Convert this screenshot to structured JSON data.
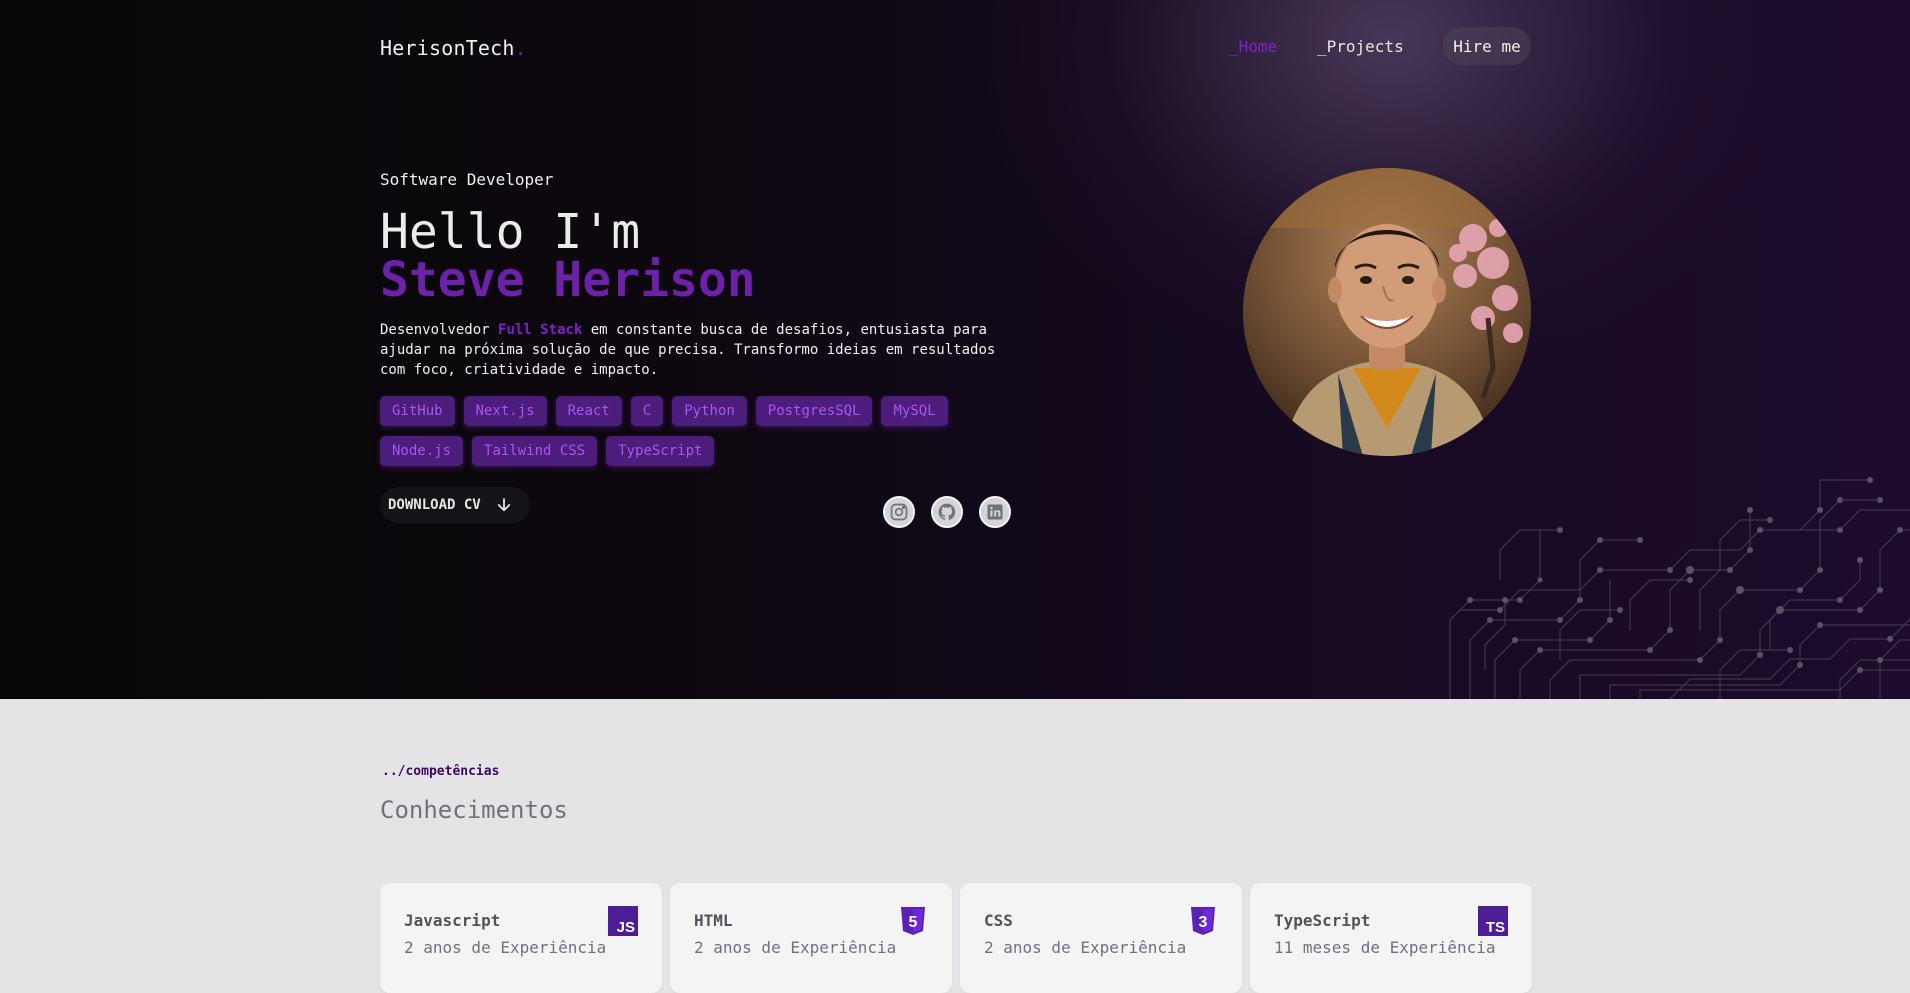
{
  "nav": {
    "logo": "HerisonTech",
    "logo_dot": ".",
    "home": "_Home",
    "projects": "_Projects",
    "hire": "Hire me"
  },
  "hero": {
    "role": "Software Developer",
    "hello": "Hello I'm",
    "name": "Steve Herison",
    "desc_pre": "Desenvolvedor ",
    "desc_highlight": "Full Stack",
    "desc_post": " em constante busca de desafios, entusiasta para ajudar na próxima solução de que precisa. Transformo ideias em resultados com foco, criatividade e impacto.",
    "tags": [
      "GitHub",
      "Next.js",
      "React",
      "C",
      "Python",
      "PostgresSQL",
      "MySQL",
      "Node.js",
      "Tailwind CSS",
      "TypeScript"
    ],
    "cv_button": "DOWNLOAD CV",
    "socials": [
      "instagram-icon",
      "github-icon",
      "linkedin-icon"
    ]
  },
  "skills": {
    "kicker": "../competências",
    "title": "Conhecimentos",
    "cards": [
      {
        "name": "Javascript",
        "experience": "2 anos de Experiência",
        "icon": "js-icon",
        "badge": "JS"
      },
      {
        "name": "HTML",
        "experience": "2 anos de Experiência",
        "icon": "html5-icon",
        "badge": "5"
      },
      {
        "name": "CSS",
        "experience": "2 anos de Experiência",
        "icon": "css3-icon",
        "badge": "3"
      },
      {
        "name": "TypeScript",
        "experience": "11 meses de Experiência",
        "icon": "ts-icon",
        "badge": "TS"
      }
    ]
  },
  "colors": {
    "accent": "#6b21a8",
    "accent_light": "#a855f7",
    "tag_bg": "#4c1d7a",
    "hero_bg": "#0d080f",
    "section_bg": "#e4e4e7"
  }
}
